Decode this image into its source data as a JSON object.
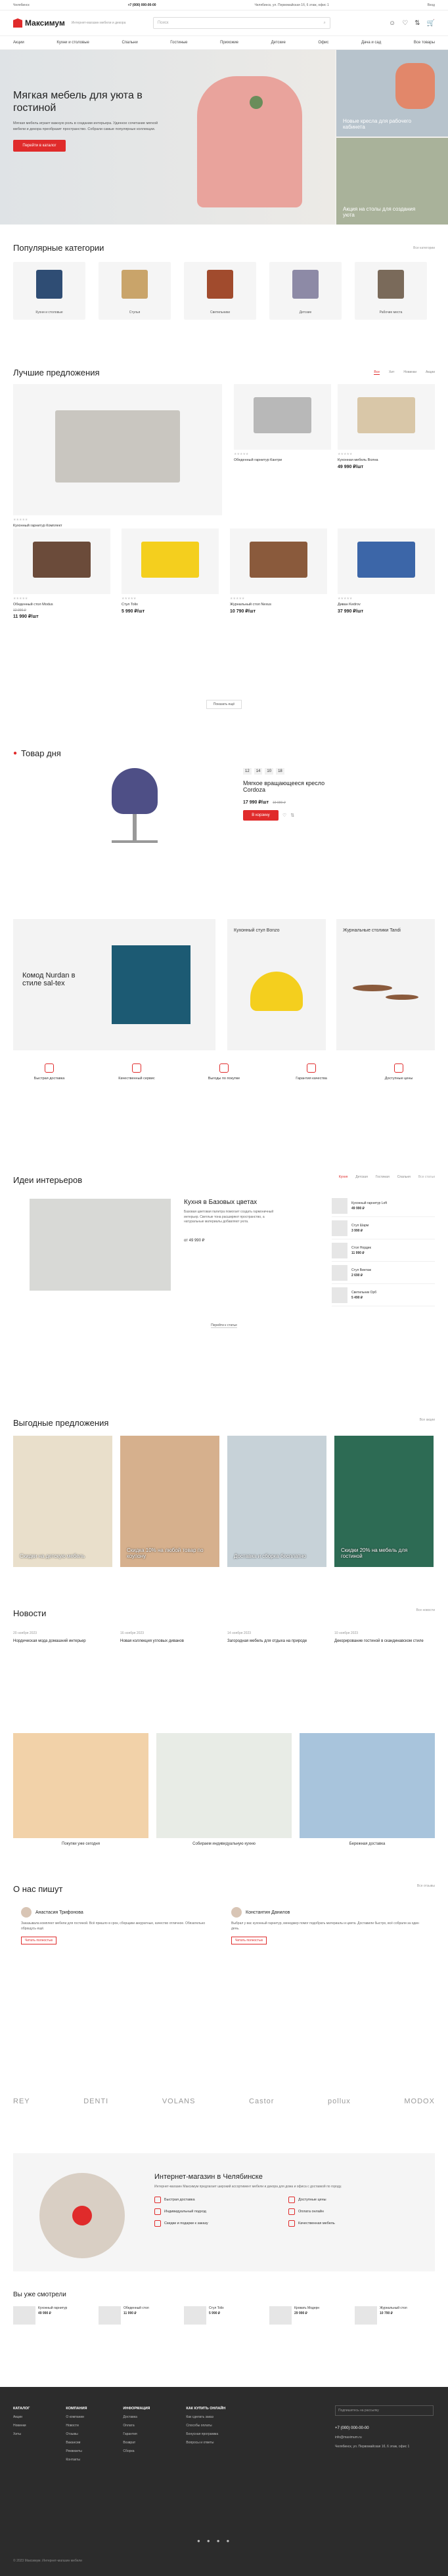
{
  "topbar": {
    "city": "Челябинск",
    "phone": "+7 (000) 000-00-00",
    "address": "Челябинск, ул. Первомайская 1б, 6 этаж, офис 1",
    "login": "Вход"
  },
  "header": {
    "logo": "Максимум",
    "tagline": "Интернет-магазин мебели и декора",
    "search_placeholder": "Поиск"
  },
  "nav": [
    "Акции",
    "Кухни и столовые",
    "Спальни",
    "Гостиные",
    "Прихожие",
    "Детские",
    "Офис",
    "Дача и сад",
    "Все товары"
  ],
  "hero": {
    "title": "Мягкая мебель для уюта в гостиной",
    "text": "Мягкая мебель играет важную роль в создании интерьера. Удачное сочетание мягкой мебели и декора преобразит пространство. Собрали самые популярные коллекции.",
    "button": "Перейти в каталог",
    "side1": "Новые кресла для рабочего кабинета",
    "side2": "Акция на столы для создания уюта"
  },
  "categories": {
    "title": "Популярные категории",
    "see": "Все категории",
    "items": [
      "Кухни и столовые",
      "Стулья",
      "Светильники",
      "Детские",
      "Рабочие места"
    ]
  },
  "offers": {
    "title": "Лучшие предложения",
    "tabs": [
      "Все",
      "Хит",
      "Новинки",
      "Акции"
    ],
    "more": "Показать ещё",
    "items": [
      {
        "name": "Кухонный гарнитур Комплект",
        "price": "",
        "old": ""
      },
      {
        "name": "Обеденный гарнитур Кантри",
        "price": "",
        "old": ""
      },
      {
        "name": "Кухонная мебель Волна",
        "price": "49 990 ₽/шт",
        "old": ""
      },
      {
        "name": "Обеденный стол Modus",
        "price": "11 990 ₽/шт",
        "old": "12 990 ₽"
      },
      {
        "name": "Стул Tolix",
        "price": "5 990 ₽/шт",
        "old": ""
      },
      {
        "name": "Журнальный стол Nexus",
        "price": "10 790 ₽/шт",
        "old": ""
      },
      {
        "name": "Диван Kedrov",
        "price": "37 990 ₽/шт",
        "old": ""
      }
    ]
  },
  "daily": {
    "title": "Товар дня",
    "name": "Мягкое вращающееся кресло Cordoza",
    "price": "17 990 ₽/шт",
    "old": "19 990 ₽",
    "button": "В корзину",
    "timer": [
      "12",
      "14",
      "10",
      "18"
    ]
  },
  "promo": {
    "big": "Комод Nurdan в стиле sal-tex",
    "mid": "Кухонный стул Bonzo",
    "right": "Журнальные столики Tandi"
  },
  "advantages": [
    "Быстрая доставка",
    "Качественный сервис",
    "Выгоды по покупке",
    "Гарантия качества",
    "Доступные цены"
  ],
  "ideas": {
    "title": "Идеи интерьеров",
    "tabs": [
      "Кухня",
      "Детская",
      "Гостиная",
      "Спальня"
    ],
    "see": "Все статьи",
    "article": "Кухня в Базовых цветах",
    "article_text": "Базовая цветовая палитра помогает создать гармоничный интерьер. Светлые тона расширяют пространство, а натуральные материалы добавляют уюта.",
    "price": "от 49 990 ₽",
    "more": "Перейти к статье",
    "side": [
      {
        "name": "Кухонный гарнитур Loft",
        "price": "49 990 ₽"
      },
      {
        "name": "Стул Шарм",
        "price": "3 990 ₽"
      },
      {
        "name": "Стол Нордик",
        "price": "11 990 ₽"
      },
      {
        "name": "Стул Винтаж",
        "price": "2 690 ₽"
      },
      {
        "name": "Светильник Орб",
        "price": "5 490 ₽"
      }
    ]
  },
  "deals": {
    "title": "Выгодные предложения",
    "see": "Все акции",
    "items": [
      "Скидки на детскую мебель",
      "Скидка 10% на любой товар по коупону",
      "Доставка и сборка бесплатно",
      "Скидки 20% на мебель для гостиной"
    ]
  },
  "news": {
    "title": "Новости",
    "see": "Все новости",
    "items": [
      {
        "date": "20 ноября 2023",
        "title": "Нордическая мода домашний интерьер"
      },
      {
        "date": "16 ноября 2023",
        "title": "Новая коллекция угловых диванов"
      },
      {
        "date": "14 ноября 2023",
        "title": "Загородная мебель для отдыха на природе"
      },
      {
        "date": "10 ноября 2023",
        "title": "Декорирование гостиной в скандинавском стиле"
      }
    ]
  },
  "services": [
    "Покупки уже сегодня",
    "Собираем индивидуальную кухню",
    "Бережная доставка"
  ],
  "reviews": {
    "title": "О нас пишут",
    "see": "Все отзывы",
    "items": [
      {
        "name": "Анастасия Трифонова",
        "text": "Заказывала комплект мебели для гостиной. Всё пришло в срок, сборщики аккуратные, качество отличное. Обязательно обращусь ещё."
      },
      {
        "name": "Константин Данилов",
        "text": "Выбрал у вас кухонный гарнитур, менеджер помог подобрать материалы и цвета. Доставили быстро, всё собрали за один день."
      }
    ],
    "more": "Читать полностью"
  },
  "brands": [
    "REY",
    "DENTI",
    "VOLANS",
    "Castor",
    "pollux",
    "MODOX"
  ],
  "about": {
    "title": "Интернет-магазин в Челябинске",
    "text": "Интернет-магазин Максимум предлагает широкий ассортимент мебели и декора для дома и офиса с доставкой по городу.",
    "features": [
      "Быстрая доставка",
      "Доступные цены",
      "Индивидуальный подход",
      "Оплата онлайн",
      "Скидки и подарки к заказу",
      "Качественная мебель"
    ]
  },
  "viewed": {
    "title": "Вы уже смотрели",
    "items": [
      {
        "name": "Кухонный гарнитур",
        "price": "49 990 ₽"
      },
      {
        "name": "Обеденный стол",
        "price": "11 990 ₽"
      },
      {
        "name": "Стул Tolix",
        "price": "5 990 ₽"
      },
      {
        "name": "Кровать Модерн",
        "price": "29 990 ₽"
      },
      {
        "name": "Журнальный стол",
        "price": "10 790 ₽"
      }
    ]
  },
  "footer": {
    "cols": [
      {
        "t": "КАТАЛОГ",
        "i": [
          "Акции",
          "Новинки",
          "Хиты"
        ]
      },
      {
        "t": "КОМПАНИЯ",
        "i": [
          "О компании",
          "Новости",
          "Отзывы",
          "Вакансии",
          "Реквизиты",
          "Контакты"
        ]
      },
      {
        "t": "ИНФОРМАЦИЯ",
        "i": [
          "Доставка",
          "Оплата",
          "Гарантия",
          "Возврат",
          "Сборка"
        ]
      },
      {
        "t": "КАК КУПИТЬ ОНЛАЙН",
        "i": [
          "Как сделать заказ",
          "Способы оплаты",
          "Бонусная программа",
          "Вопросы и ответы"
        ]
      }
    ],
    "subscribe": "Подпишитесь на рассылку",
    "phone": "+7 (000) 000-00-00",
    "email": "info@maximum.ru",
    "address": "Челябинск, ул. Первомайская 1б, 6 этаж, офис 1",
    "copyright": "© 2023 Максимум. Интернет-магазин мебели"
  }
}
